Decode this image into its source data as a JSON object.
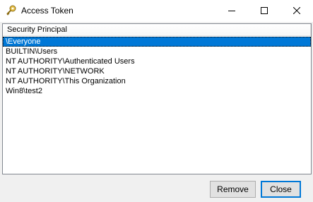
{
  "window": {
    "title": "Access Token",
    "icon": "key-icon"
  },
  "caption_buttons": {
    "minimize_icon": "minimize-icon",
    "maximize_icon": "maximize-icon",
    "close_icon": "close-icon"
  },
  "list": {
    "columns": [
      "Security Principal"
    ],
    "rows": [
      "\\Everyone",
      "BUILTIN\\Users",
      "NT AUTHORITY\\Authenticated Users",
      "NT AUTHORITY\\NETWORK",
      "NT AUTHORITY\\This Organization",
      "Win8\\test2"
    ],
    "selected_index": 0
  },
  "buttons": {
    "remove_label": "Remove",
    "close_label": "Close"
  },
  "colors": {
    "selection": "#0078d7",
    "default_button_border": "#0078d7"
  }
}
